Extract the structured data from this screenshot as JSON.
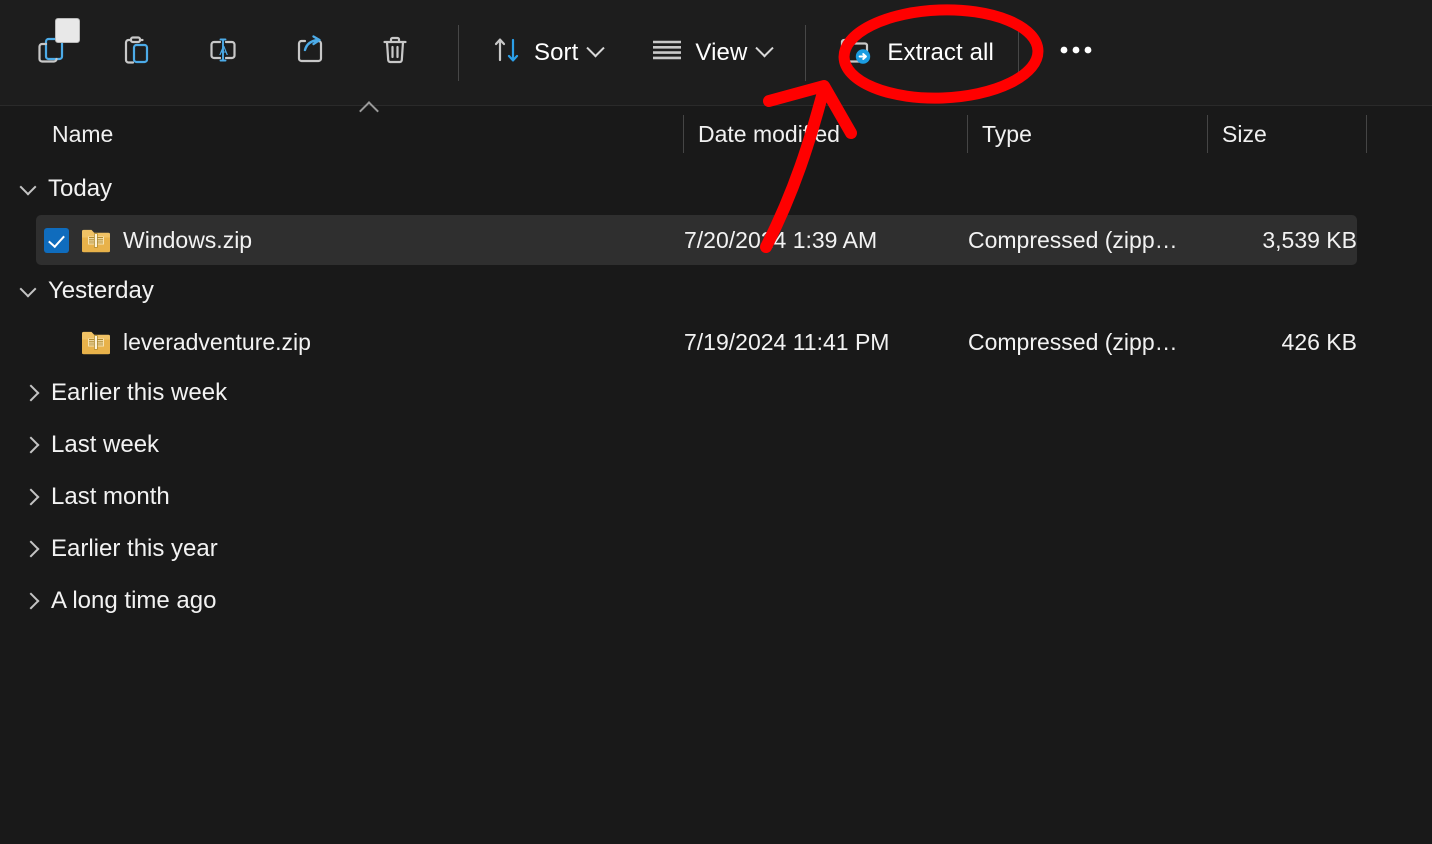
{
  "toolbar": {
    "buttons": [
      {
        "name": "copy",
        "icon": "copy-icon",
        "label": ""
      },
      {
        "name": "paste",
        "icon": "paste-icon",
        "label": ""
      },
      {
        "name": "rename",
        "icon": "rename-icon",
        "label": ""
      },
      {
        "name": "share",
        "icon": "share-icon",
        "label": ""
      },
      {
        "name": "delete",
        "icon": "trash-icon",
        "label": ""
      }
    ],
    "sort_label": "Sort",
    "view_label": "View",
    "extract_all_label": "Extract all",
    "overflow_label": "•••"
  },
  "columns": {
    "name": "Name",
    "date_modified": "Date modified",
    "type": "Type",
    "size": "Size"
  },
  "groups": [
    {
      "label": "Today",
      "expanded": true,
      "files": [
        {
          "name": "Windows.zip",
          "date_modified": "7/20/2024 1:39 AM",
          "type": "Compressed (zipp…",
          "size": "3,539 KB",
          "selected": true,
          "checked": true
        }
      ]
    },
    {
      "label": "Yesterday",
      "expanded": true,
      "files": [
        {
          "name": "leveradventure.zip",
          "date_modified": "7/19/2024 11:41 PM",
          "type": "Compressed (zipp…",
          "size": "426 KB",
          "selected": false,
          "checked": false
        }
      ]
    },
    {
      "label": "Earlier this week",
      "expanded": false,
      "files": []
    },
    {
      "label": "Last week",
      "expanded": false,
      "files": []
    },
    {
      "label": "Last month",
      "expanded": false,
      "files": []
    },
    {
      "label": "Earlier this year",
      "expanded": false,
      "files": []
    },
    {
      "label": "A long time ago",
      "expanded": false,
      "files": []
    }
  ],
  "annotations": {
    "highlight_color": "#FF0000",
    "circle_target": "Extract all",
    "arrow_points_to": "Extract all"
  },
  "colors": {
    "background": "#191919",
    "toolbar_background": "#1D1D1D",
    "selected_row": "#2F2F2F",
    "accent_blue": "#0F6CBD",
    "zip_folder": "#E8B961",
    "annotation_red": "#FF0000"
  }
}
